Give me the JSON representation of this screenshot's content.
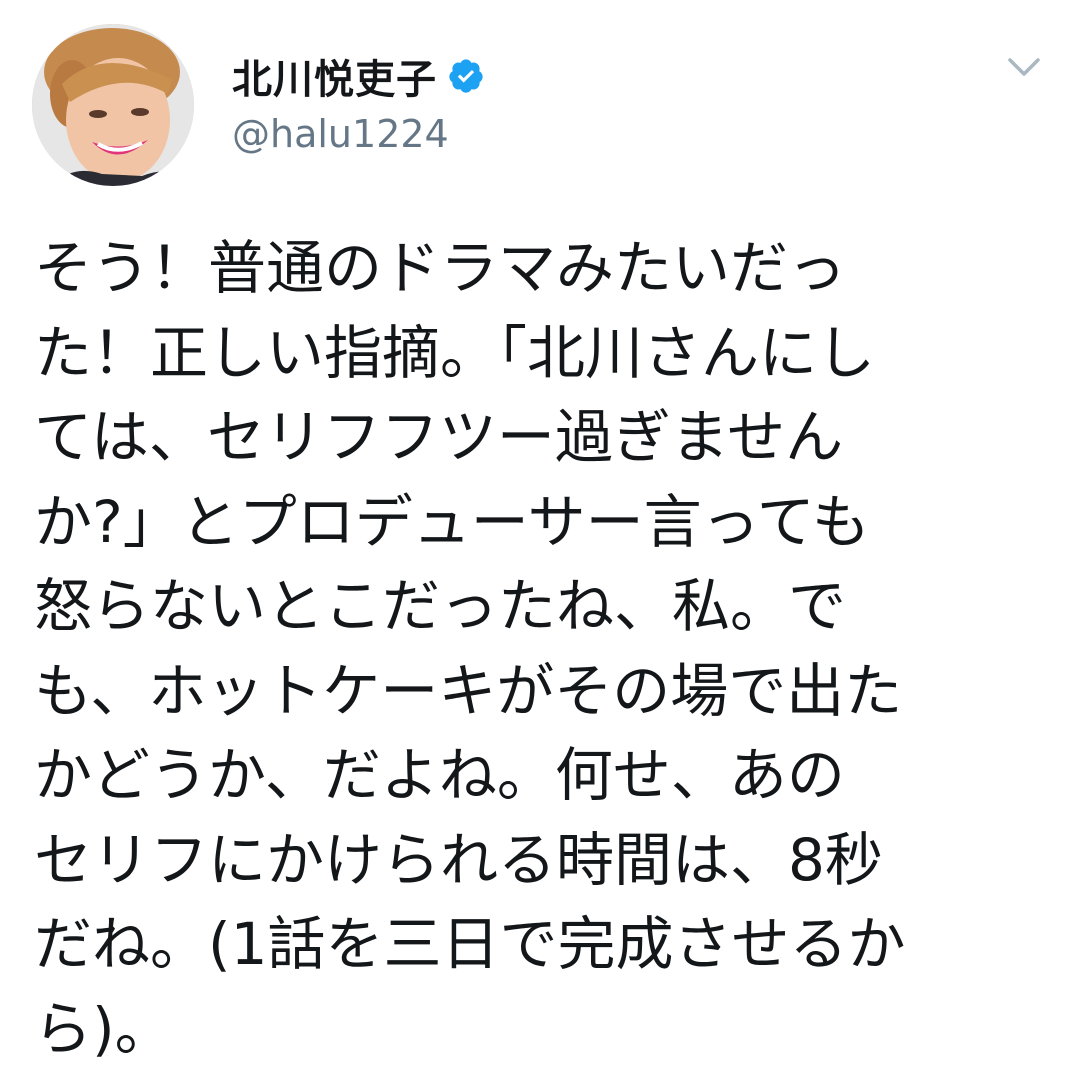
{
  "user": {
    "display_name": "北川悦吏子",
    "handle": "@halu1224",
    "verified": true
  },
  "icons": {
    "verified": "verified-badge-icon",
    "menu": "chevron-down-icon",
    "avatar": "profile-photo"
  },
  "colors": {
    "verified": "#1da1f2",
    "handle": "#657786",
    "text": "#14171a",
    "caret": "#aab8c2"
  },
  "tweet": {
    "lines": [
      "そう！普通のドラマみたいだっ",
      "た！正しい指摘。「北川さんにし",
      "ては、セリフフツー過ぎません",
      "か?」とプロデューサー言っても",
      "怒らないとこだったね、私。で",
      "も、ホットケーキがその場で出た",
      "かどうか、だよね。何せ、あの",
      "セリフにかけられる時間は、8秒",
      "だね。(1話を三日で完成させるか",
      "ら)。"
    ]
  }
}
